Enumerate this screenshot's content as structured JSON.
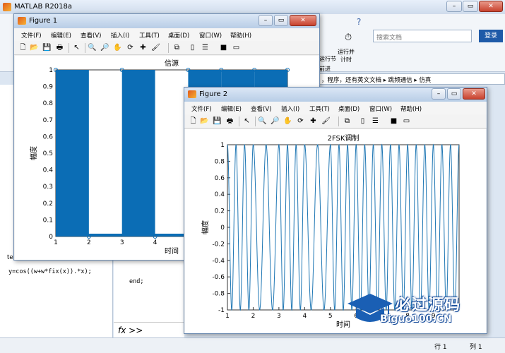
{
  "matlab": {
    "title": "MATLAB R2018a",
    "search_placeholder": "搜索文档",
    "login_label": "登录",
    "toolstrip": {
      "run_section_label": "运行节",
      "advance_label": "前进",
      "run_and_time_label": "运行并\n计时"
    },
    "breadcrumb": "，程序，还有英文文档 ▸ 跳频通信 ▸ 仿真",
    "command": "y=cos((w+w*fix(x)).*x);",
    "te_label": "te",
    "editor_end": "end;",
    "fx_prompt": "fx >>",
    "status_row": "行 1",
    "status_col": "列 1"
  },
  "menus": [
    "文件(F)",
    "编辑(E)",
    "查看(V)",
    "插入(I)",
    "工具(T)",
    "桌面(D)",
    "窗口(W)",
    "帮助(H)"
  ],
  "figure1": {
    "title": "Figure 1",
    "chart_data": {
      "type": "area",
      "title": "信源",
      "xlabel": "时间",
      "ylabel": "幅度",
      "xlim": [
        1,
        8
      ],
      "ylim": [
        0,
        1
      ],
      "x_ticks": [
        1,
        2,
        3,
        4,
        5,
        6,
        7
      ],
      "y_ticks": [
        0,
        0.1,
        0.2,
        0.3,
        0.4,
        0.5,
        0.6,
        0.7,
        0.8,
        0.9,
        1
      ],
      "series": [
        {
          "x": [
            1,
            2,
            3,
            4,
            5,
            6,
            7,
            8
          ],
          "values": [
            1,
            0,
            1,
            0,
            1,
            1,
            1,
            1
          ]
        }
      ],
      "color": "#0b6db5"
    }
  },
  "figure2": {
    "title": "Figure 2",
    "chart_data": {
      "type": "line",
      "title": "2FSK调制",
      "xlabel": "时间",
      "ylabel": "幅度",
      "xlim": [
        1,
        10
      ],
      "ylim": [
        -1,
        1
      ],
      "x_ticks": [
        1,
        2,
        3,
        4,
        5,
        6,
        7,
        8,
        9
      ],
      "y_ticks": [
        -1,
        -0.8,
        -0.6,
        -0.4,
        -0.2,
        0,
        0.2,
        0.4,
        0.6,
        0.8,
        1
      ],
      "bits": [
        1,
        0,
        1,
        0,
        1,
        1,
        1,
        1,
        1
      ],
      "cycles_per_unit_for_bit_0": 2,
      "cycles_per_unit_for_bit_1": 3,
      "color": "#1f77b4"
    }
  },
  "watermark": {
    "brand": "必过源码",
    "site": "Biguo100.CN"
  }
}
